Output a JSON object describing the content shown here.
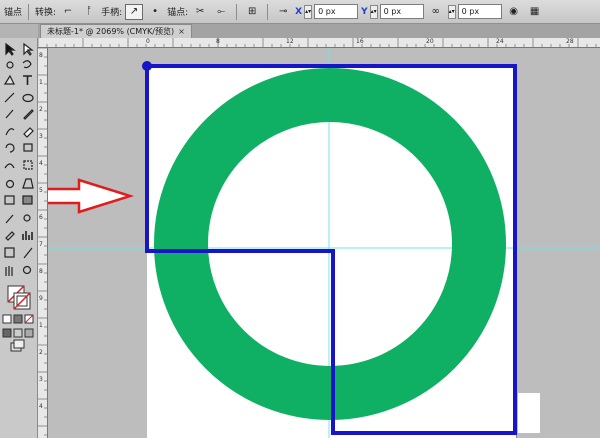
{
  "control_bar": {
    "anchor_label": "锚点",
    "convert_label": "转换:",
    "handles_label": "手柄:",
    "anchors_label": "锚点:",
    "x_label": "X",
    "x_value": "0 px",
    "y_label": "Y",
    "y_value": "0 px",
    "w_value": "0 px"
  },
  "document": {
    "tab_title": "未标题-1* @ 2069% (CMYK/预览)",
    "close_symbol": "×"
  },
  "rulers": {
    "top": [
      "",
      "0",
      "8",
      "12",
      "16",
      "20",
      "24",
      "28"
    ],
    "left": [
      "8",
      "1",
      "2",
      "3",
      "4",
      "5",
      "6",
      "7",
      "8",
      "9",
      "1",
      "2",
      "3",
      "4"
    ]
  },
  "artwork": {
    "ring_color": "#10b064",
    "outline_color": "#1616c8",
    "guide_color": "#70e3ec",
    "arrow_color": "#e21b1b"
  },
  "toolbar": {
    "icons": [
      "selection-icon",
      "direct-selection-icon",
      "magic-wand-icon",
      "lasso-icon",
      "pen-icon",
      "type-icon",
      "line-icon",
      "ellipse-icon",
      "paintbrush-icon",
      "pencil-icon",
      "blob-brush-icon",
      "eraser-icon",
      "rotate-icon",
      "scale-icon",
      "warp-icon",
      "free-transform-icon",
      "shape-builder-icon",
      "perspective-icon",
      "mesh-icon",
      "gradient-icon",
      "eyedropper-icon",
      "blend-icon",
      "symbol-sprayer-icon",
      "column-graph-icon",
      "artboard-icon",
      "slice-icon",
      "hand-icon",
      "zoom-icon"
    ]
  }
}
